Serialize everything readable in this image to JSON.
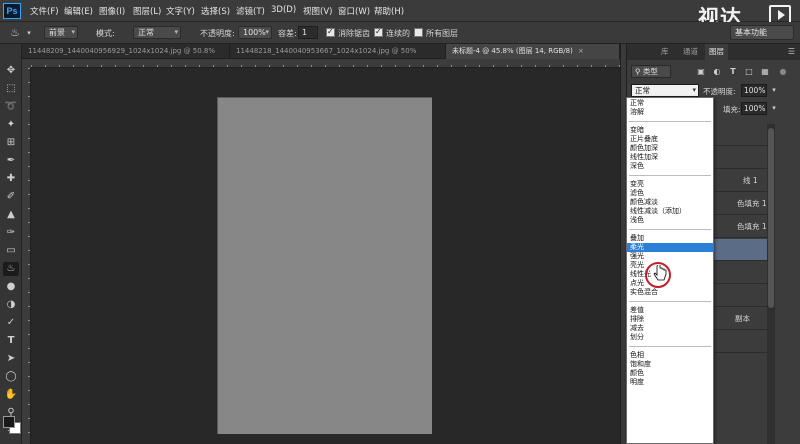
{
  "app": {
    "logo": "Ps"
  },
  "menu": [
    {
      "id": "file",
      "label": "文件(F)"
    },
    {
      "id": "edit",
      "label": "编辑(E)"
    },
    {
      "id": "image",
      "label": "图像(I)"
    },
    {
      "id": "layer",
      "label": "图层(L)"
    },
    {
      "id": "type",
      "label": "文字(Y)"
    },
    {
      "id": "select",
      "label": "选择(S)"
    },
    {
      "id": "filter",
      "label": "滤镜(T)"
    },
    {
      "id": "3d",
      "label": "3D(D)"
    },
    {
      "id": "view",
      "label": "视图(V)"
    },
    {
      "id": "window",
      "label": "窗口(W)"
    },
    {
      "id": "help",
      "label": "帮助(H)"
    }
  ],
  "watermark": {
    "text": "视达"
  },
  "options": {
    "preset": "前景",
    "mode_label": "模式:",
    "mode_value": "正常",
    "opacity_label": "不透明度:",
    "opacity_value": "100%",
    "tolerance_label": "容差:",
    "tolerance_value": "1",
    "antialias": "消除锯齿",
    "contiguous": "连续的",
    "all_layers": "所有图层",
    "workspace": "基本功能"
  },
  "tabs": [
    {
      "label": "11448209_1440040956929_1024x1024.jpg @ 50.8%"
    },
    {
      "label": "11448218_1440040953667_1024x1024.jpg @ 50%"
    },
    {
      "label": "未标题-4 @ 45.8% (图层 14, RGB/8)"
    }
  ],
  "panel": {
    "tabs": [
      "库",
      "通道",
      "图层"
    ],
    "filter_type": "类型",
    "blend_mode": "正常",
    "opacity_label": "不透明度:",
    "opacity_value": "100%",
    "fill_label": "填充:",
    "fill_value": "100%",
    "layers": [
      {
        "name": ""
      },
      {
        "name": ""
      },
      {
        "name": "线 1"
      },
      {
        "name": "色填充 1 ..."
      },
      {
        "name": "色填充 1"
      },
      {
        "name": ""
      },
      {
        "name": ""
      },
      {
        "name": ""
      },
      {
        "name": "副本"
      },
      {
        "name": ""
      }
    ]
  },
  "blend_modes": {
    "groups": [
      [
        "正常",
        "溶解"
      ],
      [
        "变暗",
        "正片叠底",
        "颜色加深",
        "线性加深",
        "深色"
      ],
      [
        "变亮",
        "滤色",
        "颜色减淡",
        "线性减淡（添加）",
        "浅色"
      ],
      [
        "叠加",
        "柔光",
        "强光",
        "亮光",
        "线性光",
        "点光",
        "实色混合"
      ],
      [
        "差值",
        "排除",
        "减去",
        "划分"
      ],
      [
        "色相",
        "饱和度",
        "颜色",
        "明度"
      ]
    ],
    "selected": "柔光"
  },
  "colors": {
    "accent": "#2b7fd6",
    "canvas": "#878787",
    "cursor_ring": "#c0202a"
  }
}
